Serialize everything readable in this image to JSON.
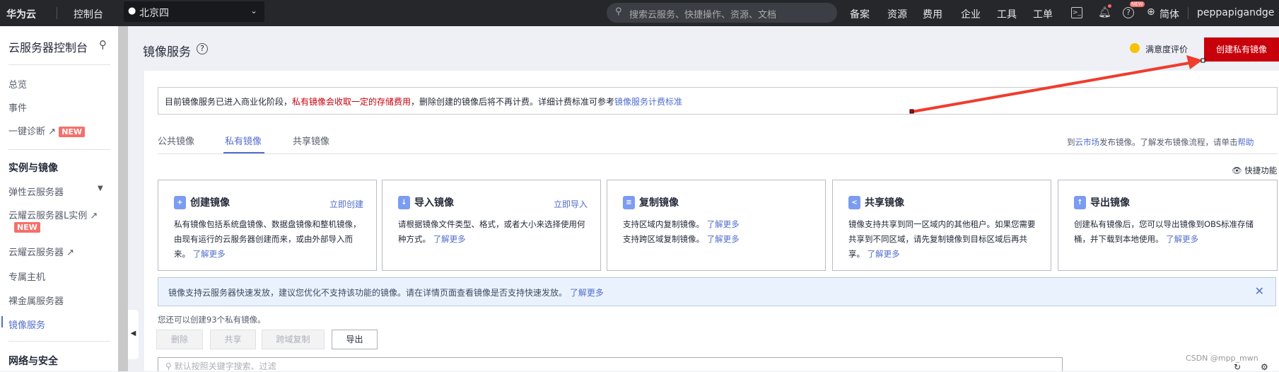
{
  "topbar": {
    "logo": "华为云",
    "console": "控制台",
    "region": "北京四",
    "search_placeholder": "搜索云服务、快捷操作、资源、文档",
    "nav": [
      "备案",
      "资源",
      "费用",
      "企业",
      "工具",
      "工单"
    ],
    "help_badge": "NEW",
    "language": "简体",
    "username": "peppapigandge"
  },
  "sidebar": {
    "title": "云服务器控制台",
    "items": [
      "总览",
      "事件",
      "一键诊断"
    ],
    "new_badge": "NEW",
    "section1": "实例与镜像",
    "section1_items": [
      "弹性云服务器",
      "云耀云服务器L实例",
      "云耀云服务器",
      "专属主机",
      "裸金属服务器",
      "镜像服务"
    ],
    "section2": "网络与安全",
    "active": "镜像服务"
  },
  "header": {
    "title": "镜像服务",
    "feedback": "满意度评价",
    "create_button": "创建私有镜像"
  },
  "notice": {
    "part1": "目前镜像服务已进入商业化阶段，",
    "highlight": "私有镜像会收取一定的存储费用",
    "part2": "，删除创建的镜像后将不再计费。详细计费标准可参考",
    "link": "镜像服务计费标准"
  },
  "tabs": [
    "公共镜像",
    "私有镜像",
    "共享镜像"
  ],
  "active_tab": "私有镜像",
  "market": {
    "prefix": "到",
    "link1": "云市场",
    "middle": "发布镜像。了解发布镜像流程，请单击",
    "link2": "帮助"
  },
  "quick": "快捷功能",
  "cards": [
    {
      "title": "创建镜像",
      "action": "立即创建",
      "desc": "私有镜像包括系统盘镜像、数据盘镜像和整机镜像，由现有运行的云服务器创建而来，或由外部导入而来。",
      "link": "了解更多"
    },
    {
      "title": "导入镜像",
      "action": "立即导入",
      "desc": "请根据镜像文件类型、格式，或者大小来选择使用何种方式。",
      "link": "了解更多"
    },
    {
      "title": "复制镜像",
      "desc": "支持区域内复制镜像。",
      "link": "了解更多",
      "desc2": "支持跨区域复制镜像。",
      "link2": "了解更多"
    },
    {
      "title": "共享镜像",
      "desc": "镜像支持共享到同一区域内的其他租户。如果您需要共享到不同区域，请先复制镜像到目标区域后再共享。",
      "link": "了解更多"
    },
    {
      "title": "导出镜像",
      "desc": "创建私有镜像后，您可以导出镜像到OBS标准存储桶，并下载到本地使用。",
      "link": "了解更多"
    }
  ],
  "banner": {
    "text": "镜像支持云服务器快速发放，建议您优化不支持该功能的镜像。请在详情页面查看镜像是否支持快速发放。",
    "link": "了解更多"
  },
  "quota": "您还可以创建93个私有镜像。",
  "actions": [
    "删除",
    "共享",
    "跨域复制",
    "导出"
  ],
  "search_placeholder": "默认按照关键字搜索、过滤",
  "watermark": "CSDN @mpp_mwn",
  "colors": {
    "accent": "#526ecc",
    "danger": "#c7000b",
    "topbar": "#25272b"
  }
}
